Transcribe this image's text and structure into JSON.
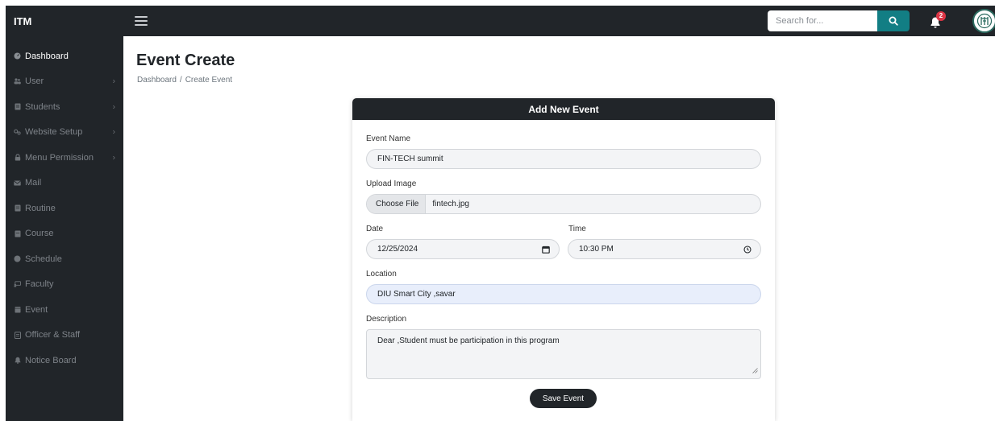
{
  "topbar": {
    "brand": "ITM",
    "search_placeholder": "Search for...",
    "notification_count": "2"
  },
  "sidebar": {
    "items": [
      {
        "label": "Dashboard",
        "icon": "dashboard-icon",
        "active": true,
        "has_submenu": false
      },
      {
        "label": "User",
        "icon": "users-icon",
        "active": false,
        "has_submenu": true
      },
      {
        "label": "Students",
        "icon": "students-icon",
        "active": false,
        "has_submenu": true
      },
      {
        "label": "Website Setup",
        "icon": "settings-icon",
        "active": false,
        "has_submenu": true
      },
      {
        "label": "Menu Permission",
        "icon": "lock-icon",
        "active": false,
        "has_submenu": true
      },
      {
        "label": "Mail",
        "icon": "mail-icon",
        "active": false,
        "has_submenu": false
      },
      {
        "label": "Routine",
        "icon": "routine-icon",
        "active": false,
        "has_submenu": false
      },
      {
        "label": "Course",
        "icon": "course-icon",
        "active": false,
        "has_submenu": false
      },
      {
        "label": "Schedule",
        "icon": "schedule-icon",
        "active": false,
        "has_submenu": false
      },
      {
        "label": "Faculty",
        "icon": "faculty-icon",
        "active": false,
        "has_submenu": false
      },
      {
        "label": "Event",
        "icon": "event-icon",
        "active": false,
        "has_submenu": false
      },
      {
        "label": "Officer & Staff",
        "icon": "staff-icon",
        "active": false,
        "has_submenu": false
      },
      {
        "label": "Notice Board",
        "icon": "bell-icon",
        "active": false,
        "has_submenu": false
      }
    ]
  },
  "page": {
    "title": "Event Create",
    "breadcrumb_home": "Dashboard",
    "breadcrumb_separator": "/",
    "breadcrumb_current": "Create Event"
  },
  "form": {
    "header": "Add New Event",
    "event_name_label": "Event Name",
    "event_name_value": "FIN-TECH summit",
    "upload_image_label": "Upload Image",
    "choose_file_label": "Choose File",
    "file_name": "fintech.jpg",
    "date_label": "Date",
    "date_value": "12/25/2024",
    "time_label": "Time",
    "time_value": "10:30 PM",
    "location_label": "Location",
    "location_value": "DIU Smart City ,savar",
    "description_label": "Description",
    "description_value": "Dear ,Student must be participation in this program",
    "save_label": "Save Event"
  },
  "colors": {
    "dark": "#212529",
    "accent": "#127e84",
    "badge": "#dc3545",
    "location_bg": "#e8eefb"
  }
}
